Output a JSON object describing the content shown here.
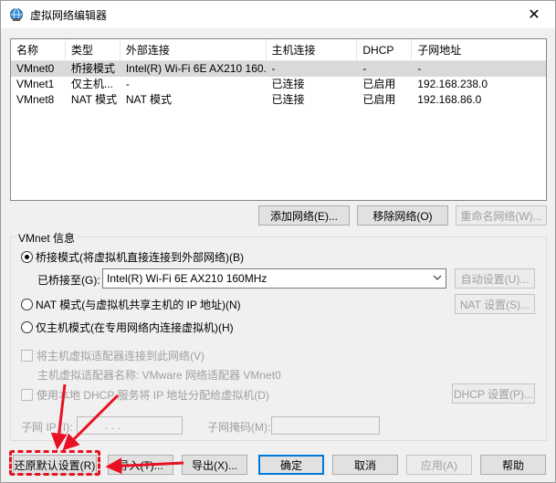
{
  "window": {
    "title": "虚拟网络编辑器",
    "close_glyph": "✕"
  },
  "network_table": {
    "headers": [
      "名称",
      "类型",
      "外部连接",
      "主机连接",
      "DHCP",
      "子网地址"
    ],
    "rows": [
      [
        "VMnet0",
        "桥接模式",
        "Intel(R) Wi-Fi 6E AX210 160...",
        "-",
        "-",
        "-"
      ],
      [
        "VMnet1",
        "仅主机...",
        "-",
        "已连接",
        "已启用",
        "192.168.238.0"
      ],
      [
        "VMnet8",
        "NAT 模式",
        "NAT 模式",
        "已连接",
        "已启用",
        "192.168.86.0"
      ]
    ]
  },
  "network_buttons": {
    "add": "添加网络(E)...",
    "remove": "移除网络(O)",
    "rename": "重命名网络(W)..."
  },
  "vmnet_info": {
    "group_title": "VMnet 信息",
    "bridged_radio": "桥接模式(将虚拟机直接连接到外部网络)(B)",
    "bridged_to_label": "已桥接至(G):",
    "bridged_to_value": "Intel(R) Wi-Fi 6E AX210 160MHz",
    "auto_settings": "自动设置(U)...",
    "nat_radio": "NAT 模式(与虚拟机共享主机的 IP 地址)(N)",
    "nat_settings": "NAT 设置(S)...",
    "hostonly_radio": "仅主机模式(在专用网络内连接虚拟机)(H)",
    "connect_adapter_check": "将主机虚拟适配器连接到此网络(V)",
    "adapter_name_label": "主机虚拟适配器名称: VMware 网络适配器 VMnet0",
    "dhcp_check": "使用本地 DHCP 服务将 IP 地址分配给虚拟机(D)",
    "dhcp_settings": "DHCP 设置(P)...",
    "subnet_ip_label": "子网 IP (I):",
    "subnet_mask_label": "子网掩码(M):",
    "ip_dots": ".    .    ."
  },
  "footer_buttons": {
    "restore": "还原默认设置(R)",
    "import": "导入(T)...",
    "export": "导出(X)...",
    "ok": "确定",
    "cancel": "取消",
    "apply": "应用(A)",
    "help": "帮助"
  },
  "colors": {
    "annotation": "#e81123",
    "selection": "#d9d9d9",
    "focus": "#0078d7"
  }
}
